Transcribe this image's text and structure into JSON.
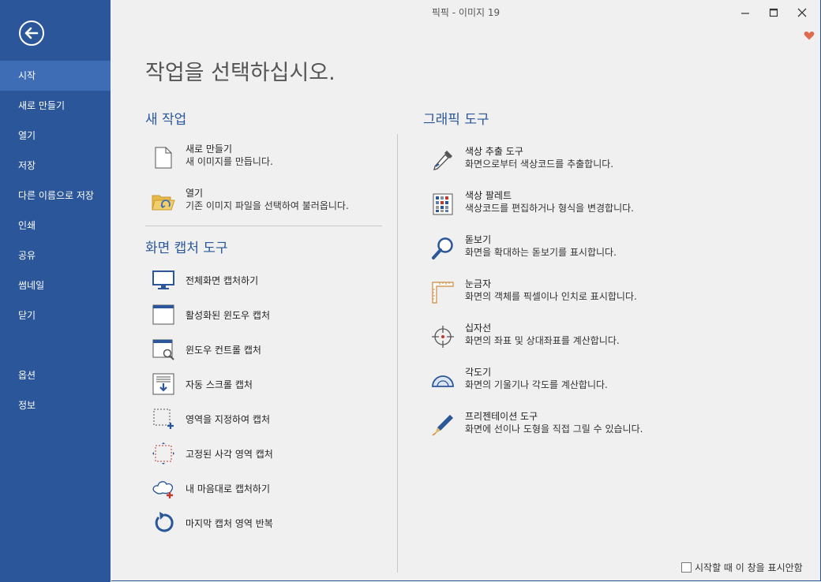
{
  "window": {
    "title": "픽픽 - 이미지 19"
  },
  "sidebar": {
    "items": [
      {
        "label": "시작",
        "active": true
      },
      {
        "label": "새로 만들기"
      },
      {
        "label": "열기"
      },
      {
        "label": "저장"
      },
      {
        "label": "다른 이름으로 저장"
      },
      {
        "label": "인쇄"
      },
      {
        "label": "공유"
      },
      {
        "label": "썸네일"
      },
      {
        "label": "닫기"
      },
      {
        "label": "옵션"
      },
      {
        "label": "정보"
      }
    ]
  },
  "main": {
    "title": "작업을 선택하십시오.",
    "new_task": {
      "heading": "새 작업",
      "items": [
        {
          "icon": "document-icon",
          "title": "새로 만들기",
          "desc": "새 이미지를 만듭니다."
        },
        {
          "icon": "folder-open-icon",
          "title": "열기",
          "desc": "기존 이미지 파일을 선택하여 불러옵니다."
        }
      ]
    },
    "capture": {
      "heading": "화면 캡처 도구",
      "items": [
        {
          "icon": "monitor-icon",
          "title": "전체화면 캡처하기"
        },
        {
          "icon": "active-window-icon",
          "title": "활성화된 윈도우 캡처"
        },
        {
          "icon": "window-control-icon",
          "title": "윈도우 컨트롤 캡처"
        },
        {
          "icon": "scroll-capture-icon",
          "title": "자동 스크롤 캡처"
        },
        {
          "icon": "region-icon",
          "title": "영역을 지정하여 캡처"
        },
        {
          "icon": "fixed-region-icon",
          "title": "고정된 사각 영역 캡처"
        },
        {
          "icon": "freehand-icon",
          "title": "내 마음대로 캡처하기"
        },
        {
          "icon": "repeat-icon",
          "title": "마지막 캡처 영역 반복"
        }
      ]
    },
    "graphics": {
      "heading": "그래픽 도구",
      "items": [
        {
          "icon": "eyedropper-icon",
          "title": "색상 추출 도구",
          "desc": "화면으로부터 색상코드를 추출합니다."
        },
        {
          "icon": "palette-icon",
          "title": "색상 팔레트",
          "desc": "색상코드를 편집하거나 형식을 변경합니다."
        },
        {
          "icon": "magnifier-icon",
          "title": "돋보기",
          "desc": "화면을 확대하는 돋보기를 표시합니다."
        },
        {
          "icon": "ruler-icon",
          "title": "눈금자",
          "desc": "화면의 객체를 픽셀이나 인치로 표시합니다."
        },
        {
          "icon": "crosshair-icon",
          "title": "십자선",
          "desc": "화면의 좌표 및 상대좌표를 계산합니다."
        },
        {
          "icon": "protractor-icon",
          "title": "각도기",
          "desc": "화면의 기울기나 각도를 계산합니다."
        },
        {
          "icon": "pen-icon",
          "title": "프리젠테이션 도구",
          "desc": "화면에 선이나 도형을 직접 그릴 수 있습니다."
        }
      ]
    },
    "footer": {
      "checkbox_label": "시작할 때 이 창을 표시안함",
      "checked": false
    }
  }
}
